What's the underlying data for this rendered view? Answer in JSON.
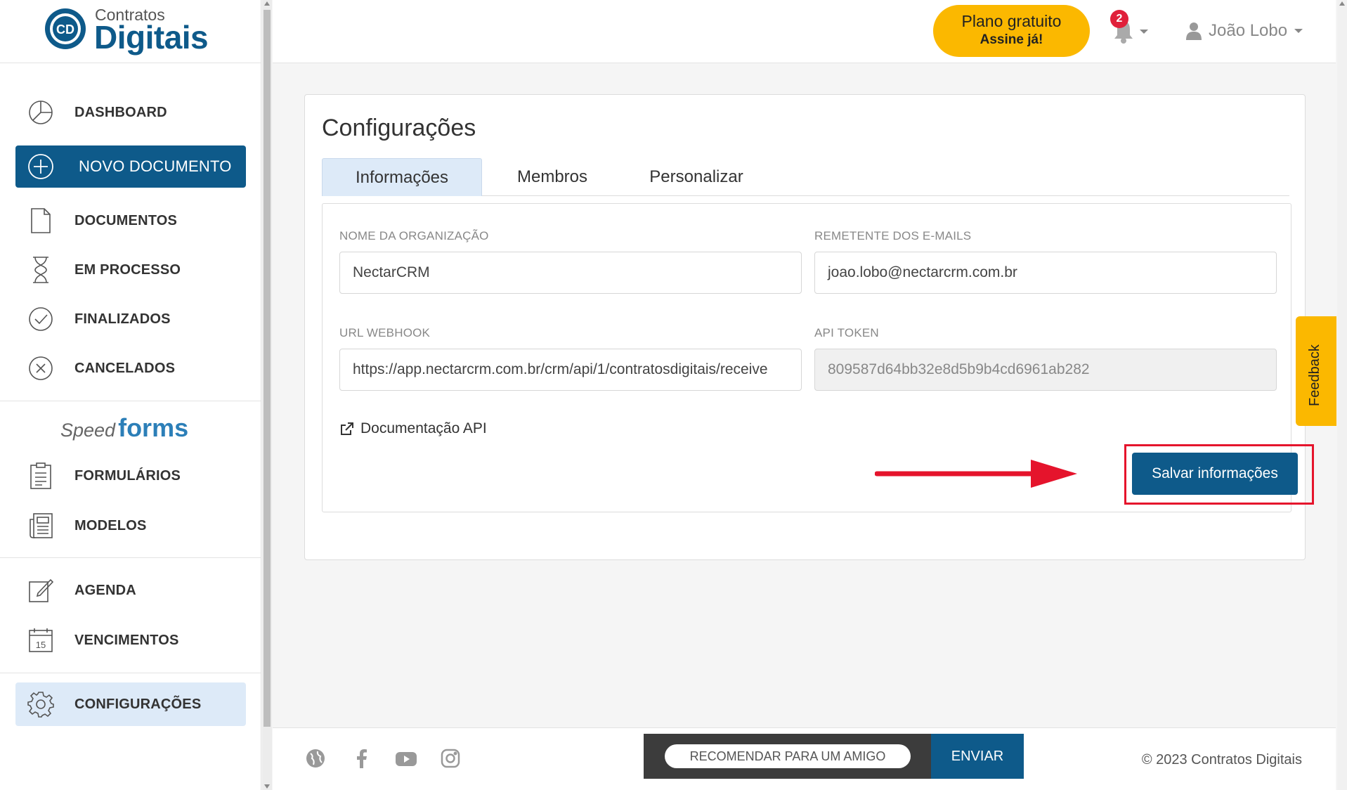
{
  "brand": {
    "logo_top": "Contratos",
    "logo_bottom": "Digitais",
    "primary_color": "#0e5a8a",
    "accent_color": "#fbb800"
  },
  "sidebar": {
    "items": [
      {
        "label": "DASHBOARD",
        "icon": "pie-chart-icon"
      },
      {
        "label": "NOVO DOCUMENTO",
        "icon": "plus-circle-icon"
      },
      {
        "label": "DOCUMENTOS",
        "icon": "document-icon"
      },
      {
        "label": "EM PROCESSO",
        "icon": "hourglass-icon"
      },
      {
        "label": "FINALIZADOS",
        "icon": "check-circle-icon"
      },
      {
        "label": "CANCELADOS",
        "icon": "x-circle-icon"
      }
    ],
    "speedforms": {
      "speed": "Speed",
      "forms": "forms"
    },
    "forms_items": [
      {
        "label": "FORMULÁRIOS",
        "icon": "clipboard-icon"
      },
      {
        "label": "MODELOS",
        "icon": "newspaper-icon"
      }
    ],
    "other_items": [
      {
        "label": "AGENDA",
        "icon": "edit-icon"
      },
      {
        "label": "VENCIMENTOS",
        "icon": "calendar-icon",
        "day": "15"
      }
    ],
    "settings": {
      "label": "CONFIGURAÇÕES",
      "icon": "gear-icon"
    }
  },
  "header": {
    "plan_line1": "Plano gratuito",
    "plan_line2": "Assine já!",
    "notifications": "2",
    "user_name": "João Lobo"
  },
  "feedback": "Feedback",
  "main": {
    "title": "Configurações",
    "tabs": [
      {
        "label": "Informações",
        "active": true
      },
      {
        "label": "Membros",
        "active": false
      },
      {
        "label": "Personalizar",
        "active": false
      }
    ],
    "fields": {
      "org_label": "NOME DA ORGANIZAÇÃO",
      "org_value": "NectarCRM",
      "sender_label": "REMETENTE DOS E-MAILS",
      "sender_value": "joao.lobo@nectarcrm.com.br",
      "webhook_label": "URL WEBHOOK",
      "webhook_value": "https://app.nectarcrm.com.br/crm/api/1/contratosdigitais/receive",
      "token_label": "API TOKEN",
      "token_value": "809587d64bb32e8d5b9b4cd6961ab282"
    },
    "doc_link": "Documentação API",
    "save_label": "Salvar informações"
  },
  "footer": {
    "recommend_placeholder": "RECOMENDAR PARA UM AMIGO",
    "send_label": "ENVIAR",
    "copyright": "© 2023 Contratos Digitais"
  }
}
